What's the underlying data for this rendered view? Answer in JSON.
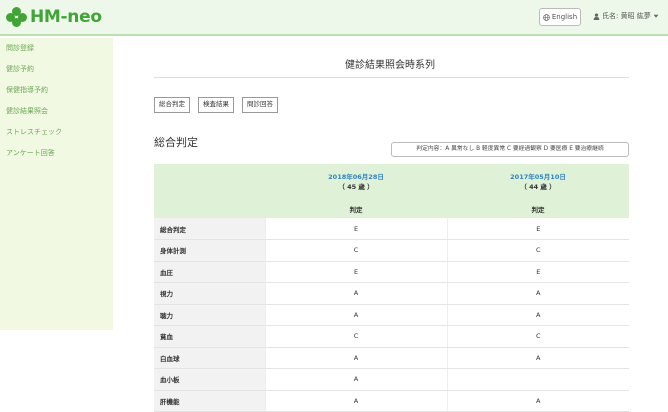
{
  "app": {
    "logo_text": "HM-neo"
  },
  "header": {
    "lang_label": "English",
    "user_label": "氏名: 黄昭 紘夢"
  },
  "sidebar": {
    "items": [
      {
        "label": "問診登録"
      },
      {
        "label": "健診予約"
      },
      {
        "label": "保健指導予約"
      },
      {
        "label": "健診結果照会"
      },
      {
        "label": "ストレスチェック"
      },
      {
        "label": "アンケート回答"
      }
    ]
  },
  "main": {
    "title": "健診結果照会時系列",
    "buttons": [
      {
        "label": "総合判定"
      },
      {
        "label": "検査結果"
      },
      {
        "label": "問診回答"
      }
    ],
    "section_title": "総合判定",
    "legend": "判定内容：A 異常なし B 軽度異常 C 要経過観察 D 要医療 E 要治療継続"
  },
  "table": {
    "columns": [
      {
        "date": "2018年06月28日",
        "age": "（ 45 歳 ）",
        "sub": "判定"
      },
      {
        "date": "2017年05月10日",
        "age": "（ 44 歳 ）",
        "sub": "判定"
      }
    ],
    "rows": [
      {
        "label": "総合判定",
        "values": [
          "E",
          "E"
        ]
      },
      {
        "label": "身体計測",
        "values": [
          "C",
          "C"
        ]
      },
      {
        "label": "血圧",
        "values": [
          "E",
          "E"
        ]
      },
      {
        "label": "視力",
        "values": [
          "A",
          "A"
        ]
      },
      {
        "label": "聴力",
        "values": [
          "A",
          "A"
        ]
      },
      {
        "label": "貧血",
        "values": [
          "C",
          "C"
        ]
      },
      {
        "label": "白血球",
        "values": [
          "A",
          "A"
        ]
      },
      {
        "label": "血小板",
        "values": [
          "A",
          ""
        ]
      },
      {
        "label": "肝機能",
        "values": [
          "A",
          "A"
        ]
      }
    ]
  },
  "colors": {
    "brand_green": "#3fa535",
    "header_bg": "#edf7ea",
    "sidebar_bg": "#f1f9e3",
    "date_blue": "#2e84c6"
  }
}
